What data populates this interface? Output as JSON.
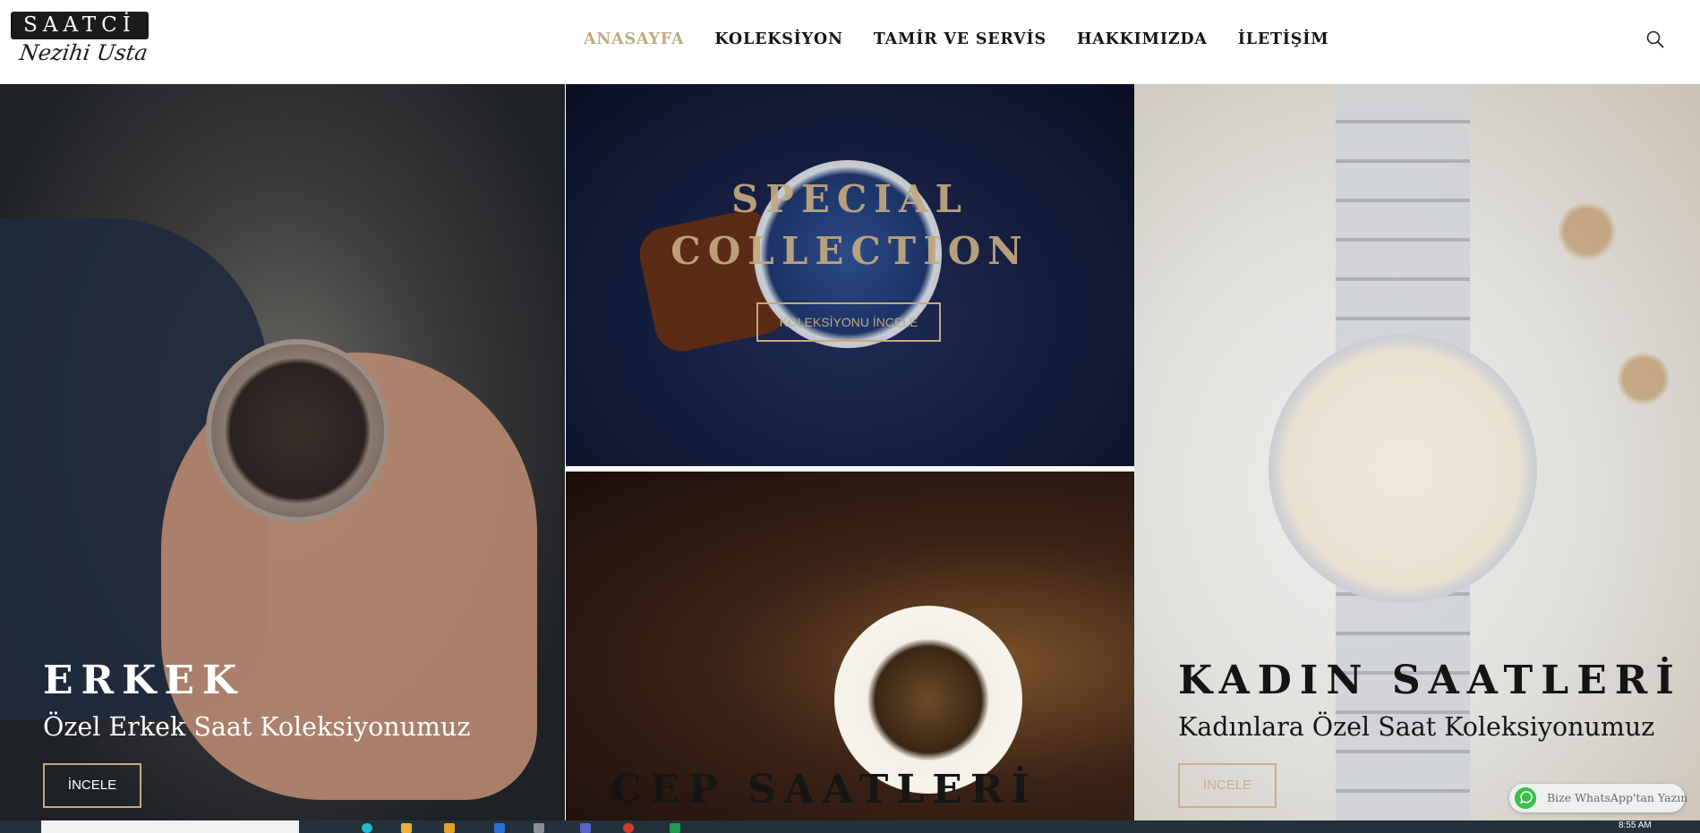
{
  "header": {
    "logo": {
      "top": "SAATCİ",
      "script": "Nezihi Usta"
    },
    "nav": [
      {
        "label": "ANASAYFA",
        "active": true
      },
      {
        "label": "KOLEKSİYON",
        "active": false
      },
      {
        "label": "TAMİR VE SERVİS",
        "active": false
      },
      {
        "label": "HAKKIMIZDA",
        "active": false
      },
      {
        "label": "İLETİŞİM",
        "active": false
      }
    ],
    "search_icon": "search-icon"
  },
  "panels": {
    "erkek": {
      "title": "ERKEK",
      "subtitle": "Özel Erkek Saat Koleksiyonumuz",
      "button": "İNCELE"
    },
    "special": {
      "title_line1": "SPECIAL",
      "title_line2": "COLLECTION",
      "button": "KOLEKSİYONU İNCELE"
    },
    "cep": {
      "title": "CEP SAATLERİ"
    },
    "kadin": {
      "title": "KADIN SAATLERİ",
      "subtitle": "Kadınlara Özel Saat Koleksiyonumuz",
      "button": "İNCELE"
    }
  },
  "whatsapp": {
    "label": "Bize WhatsApp'tan Yazın",
    "icon": "whatsapp-icon"
  },
  "taskbar": {
    "time": "8:55 AM"
  },
  "colors": {
    "accent": "#c4a97f",
    "dark": "#151515",
    "whatsapp": "#3bbf4c"
  }
}
